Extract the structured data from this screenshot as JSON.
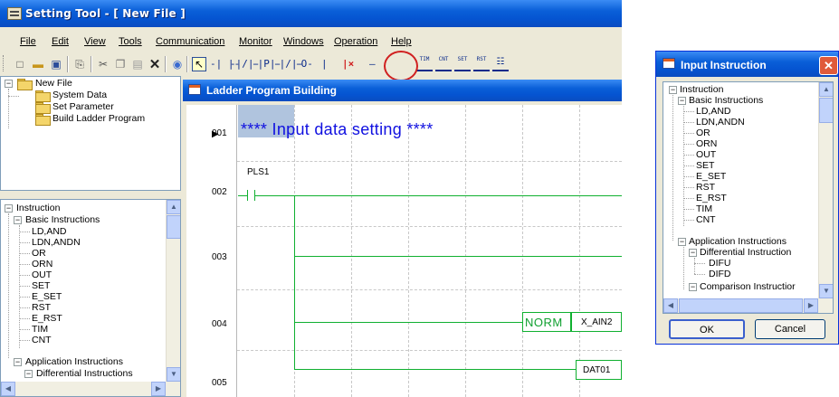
{
  "window": {
    "title": "Setting Tool - [ New File ]"
  },
  "menu": [
    "File",
    "Edit",
    "View",
    "Tools",
    "Communication",
    "Monitor",
    "Windows",
    "Operation",
    "Help"
  ],
  "toolbar": {
    "mini_buttons": [
      "TIM",
      "CNT",
      "SET",
      "RST"
    ]
  },
  "project_tree": {
    "root": "New File",
    "children": [
      "System Data",
      "Set Parameter",
      "Build Ladder Program"
    ]
  },
  "instruction_tree": {
    "root": "Instruction",
    "basic": {
      "label": "Basic Instructions",
      "items": [
        "LD,AND",
        "LDN,ANDN",
        "OR",
        "ORN",
        "OUT",
        "SET",
        "E_SET",
        "RST",
        "E_RST",
        "TIM",
        "CNT"
      ]
    },
    "application": {
      "label": "Application Instructions",
      "differential_label": "Differential Instructions"
    }
  },
  "ladder": {
    "title": "Ladder Program Building",
    "rows": [
      "001",
      "002",
      "003",
      "004",
      "005"
    ],
    "comment": "**** Input data setting ****",
    "contact_label": "PLS1",
    "function_name": "NORM",
    "function_arg": "X_AIN2",
    "output_arg": "DAT01"
  },
  "dialog": {
    "title": "Input Instruction",
    "tree": {
      "root": "Instruction",
      "basic_label": "Basic Instructions",
      "basic_items": [
        "LD,AND",
        "LDN,ANDN",
        "OR",
        "ORN",
        "OUT",
        "SET",
        "E_SET",
        "RST",
        "E_RST",
        "TIM",
        "CNT"
      ],
      "application_label": "Application Instructions",
      "differential_label": "Differential Instruction",
      "differential_items": [
        "DIFU",
        "DIFD"
      ],
      "comparison_label": "Comparison Instructior"
    },
    "ok_label": "OK",
    "cancel_label": "Cancel"
  },
  "colors": {
    "title_bar": "#0554d1",
    "ladder_wire": "#10b030",
    "comment_text": "#1010e0",
    "selection": "#b0c4de",
    "highlight_circle": "#d02020"
  }
}
